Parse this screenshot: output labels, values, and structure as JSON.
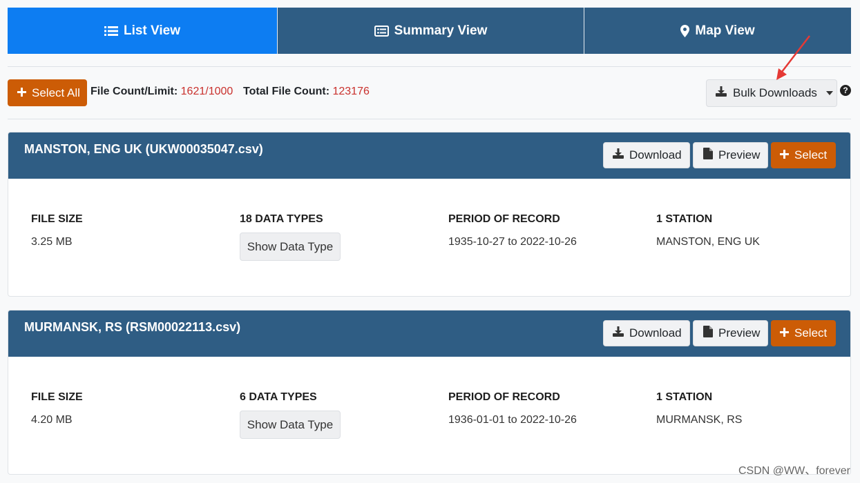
{
  "tabs": [
    {
      "label": "List View",
      "icon": "list-icon",
      "active": true
    },
    {
      "label": "Summary View",
      "icon": "summary-icon",
      "active": false
    },
    {
      "label": "Map View",
      "icon": "map-marker-icon",
      "active": false
    }
  ],
  "toolbar": {
    "select_all_label": "Select All",
    "file_count_label": "File Count/Limit:",
    "file_count_value": "1621/1000",
    "total_label": "Total File Count:",
    "total_value": "123176",
    "bulk_label": "Bulk Downloads",
    "help": "?"
  },
  "cards": [
    {
      "title": "MANSTON, ENG UK (UKW00035047.csv)",
      "download_label": "Download",
      "preview_label": "Preview",
      "select_label": "Select",
      "file_size_label": "FILE SIZE",
      "file_size_value": "3.25 MB",
      "data_types_label": "18 DATA TYPES",
      "show_data_type_label": "Show Data Type",
      "period_label": "PERIOD OF RECORD",
      "period_value": "1935-10-27 to 2022-10-26",
      "station_label": "1 STATION",
      "station_value": "MANSTON, ENG UK"
    },
    {
      "title": "MURMANSK, RS (RSM00022113.csv)",
      "download_label": "Download",
      "preview_label": "Preview",
      "select_label": "Select",
      "file_size_label": "FILE SIZE",
      "file_size_value": "4.20 MB",
      "data_types_label": "6 DATA TYPES",
      "show_data_type_label": "Show Data Type",
      "period_label": "PERIOD OF RECORD",
      "period_value": "1936-01-01 to 2022-10-26",
      "station_label": "1 STATION",
      "station_value": "MURMANSK, RS"
    }
  ],
  "watermark": "CSDN @WW、forever",
  "colors": {
    "tab_active": "#0d7df2",
    "tab_inactive": "#2f5d84",
    "accent_orange": "#cc5c06",
    "count_red": "#c9302c",
    "annotation_arrow": "#e53935"
  }
}
